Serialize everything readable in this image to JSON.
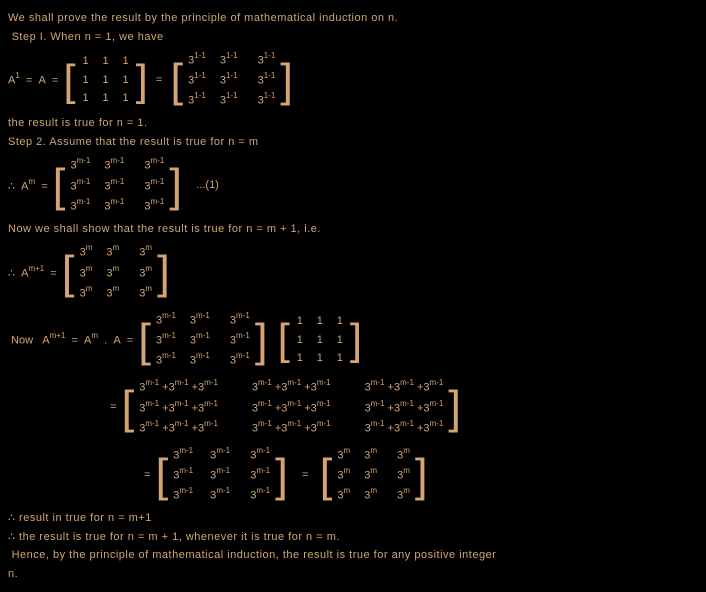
{
  "lines": {
    "l1": "We shall prove the result by the principle of mathematical induction on n.",
    "l2": "Step I. When n = 1, we have",
    "l3_pre": "A¹ = A =",
    "l3_eq": "=",
    "l4": "the result is true for n = 1.",
    "l5": "Step 2. Assume that the result is true for n = m",
    "l6_pre": "∴ Aᵐ =",
    "l6_post": "...(1)",
    "l7": "Now we shall show that the result is true for n = m + 1, i.e.",
    "l8_pre": "∴ Aᵐ⁺¹ =",
    "l9_pre": "Now   Aᵐ⁺¹ = Aᵐ . A =",
    "l10_eq": "=",
    "l11_eq": "=",
    "l11_eq2": "=",
    "l12": "∴ result in true for n = m+1",
    "l13": "∴ the result is true for n = m + 1, whenever it is true for n = m.",
    "l14": "Hence, by the principle of mathematical induction, the result is true for any positive integer",
    "l15": "n."
  },
  "matrices": {
    "ones": [
      [
        "1",
        "1",
        "1"
      ],
      [
        "1",
        "1",
        "1"
      ],
      [
        "1",
        "1",
        "1"
      ]
    ],
    "three1": [
      [
        "3¹⁻¹",
        "3¹⁻¹",
        "3¹⁻¹"
      ],
      [
        "3¹⁻¹",
        "3¹⁻¹",
        "3¹⁻¹"
      ],
      [
        "3¹⁻¹",
        "3¹⁻¹",
        "3¹⁻¹"
      ]
    ],
    "threem1": [
      [
        "3ᵐ⁻¹",
        "3ᵐ⁻¹",
        "3ᵐ⁻¹"
      ],
      [
        "3ᵐ⁻¹",
        "3ᵐ⁻¹",
        "3ᵐ⁻¹"
      ],
      [
        "3ᵐ⁻¹",
        "3ᵐ⁻¹",
        "3ᵐ⁻¹"
      ]
    ],
    "threem": [
      [
        "3ᵐ",
        "3ᵐ",
        "3ᵐ"
      ],
      [
        "3ᵐ",
        "3ᵐ",
        "3ᵐ"
      ],
      [
        "3ᵐ",
        "3ᵐ",
        "3ᵐ"
      ]
    ],
    "sum": [
      [
        "3ᵐ⁻¹ +3ᵐ⁻¹ +3ᵐ⁻¹",
        "3ᵐ⁻¹ +3ᵐ⁻¹ +3ᵐ⁻¹",
        "3ᵐ⁻¹ +3ᵐ⁻¹ +3ᵐ⁻¹"
      ],
      [
        "3ᵐ⁻¹ +3ᵐ⁻¹ +3ᵐ⁻¹",
        "3ᵐ⁻¹ +3ᵐ⁻¹ +3ᵐ⁻¹",
        "3ᵐ⁻¹ +3ᵐ⁻¹ +3ᵐ⁻¹"
      ],
      [
        "3ᵐ⁻¹ +3ᵐ⁻¹ +3ᵐ⁻¹",
        "3ᵐ⁻¹ +3ᵐ⁻¹ +3ᵐ⁻¹",
        "3ᵐ⁻¹ +3ᵐ⁻¹ +3ᵐ⁻¹"
      ]
    ]
  },
  "exp": {
    "m1": "m-1",
    "m": "m",
    "one1": "1-1"
  }
}
